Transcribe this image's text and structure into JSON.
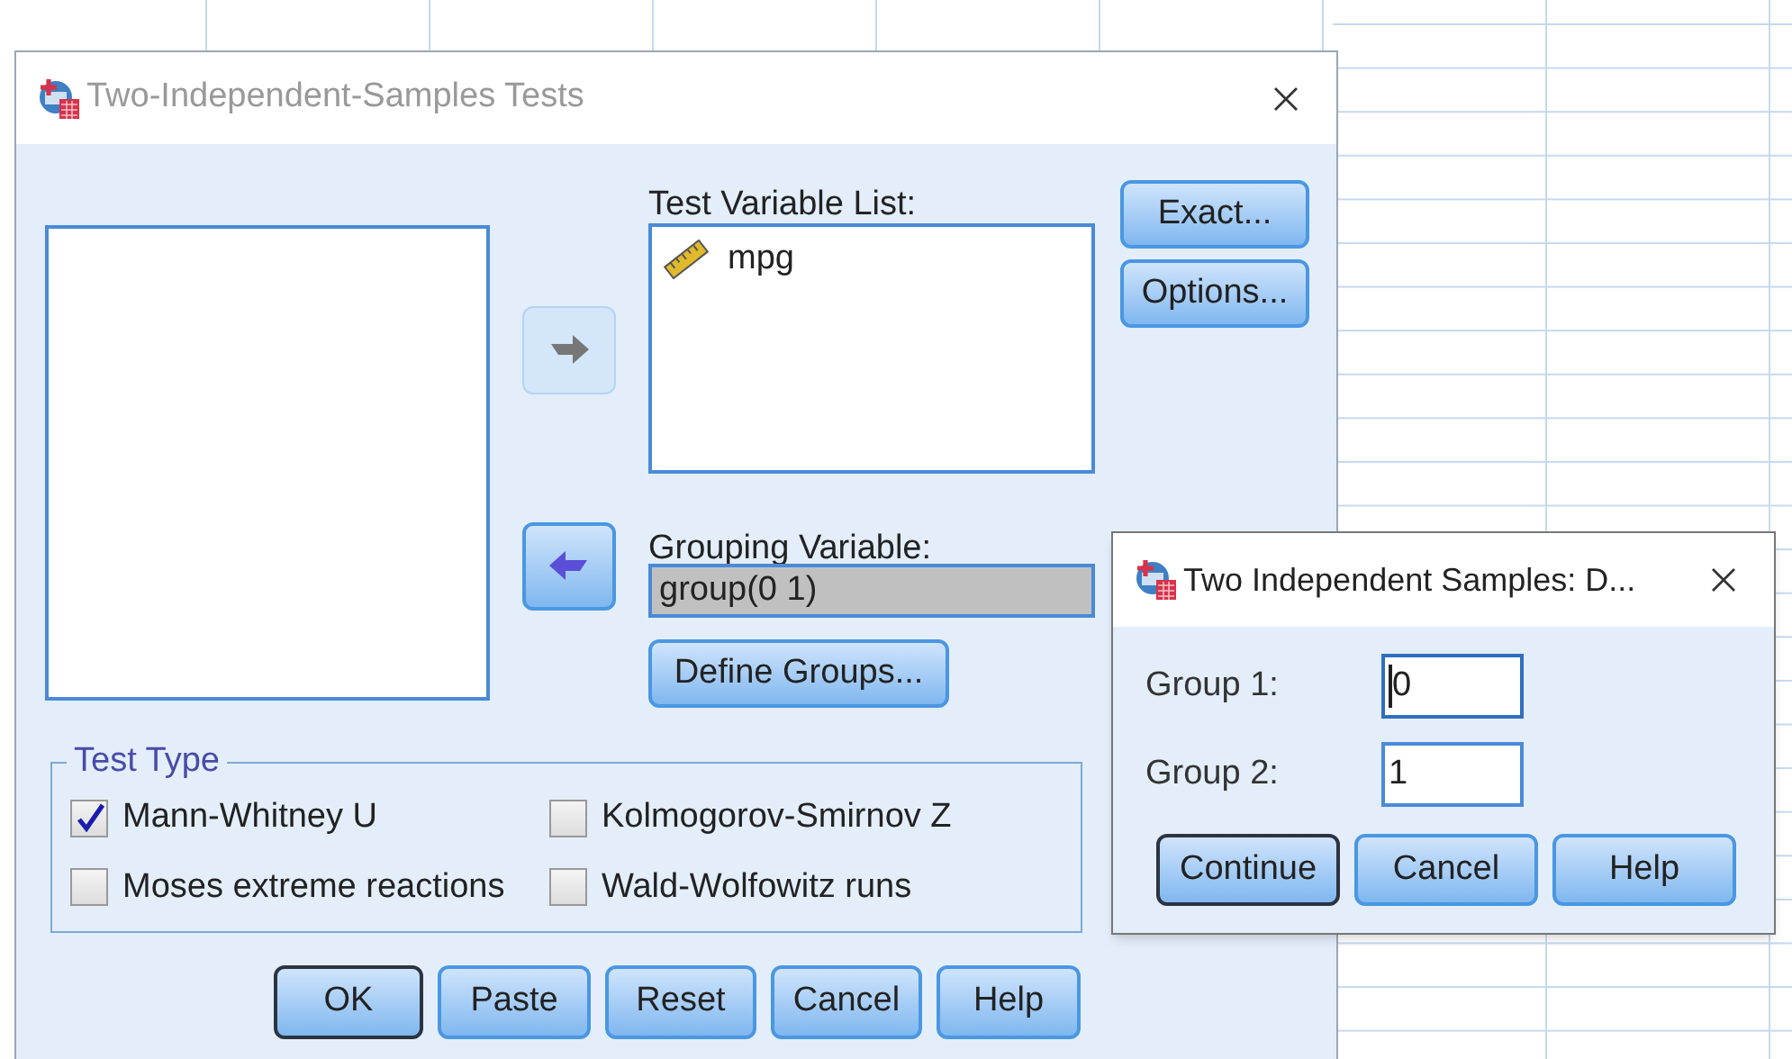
{
  "main_dialog": {
    "title": "Two-Independent-Samples Tests",
    "move_buttons": [
      {
        "disabled": true
      },
      {
        "disabled": false
      }
    ],
    "test_variable_list": {
      "label": "Test Variable List:",
      "items": [
        {
          "name": "mpg"
        }
      ]
    },
    "side_buttons": [
      "Exact...",
      "Options..."
    ],
    "grouping_variable": {
      "label": "Grouping Variable:",
      "value": "group(0 1)"
    },
    "define_groups_button": "Define Groups...",
    "test_type": {
      "title": "Test Type",
      "options": [
        {
          "label": "Mann-Whitney U",
          "checked": true
        },
        {
          "label": "Kolmogorov-Smirnov Z",
          "checked": false
        },
        {
          "label": "Moses extreme reactions",
          "checked": false
        },
        {
          "label": "Wald-Wolfowitz runs",
          "checked": false
        }
      ]
    },
    "buttons": [
      {
        "label": "OK",
        "default": true
      },
      {
        "label": "Paste",
        "default": false
      },
      {
        "label": "Reset",
        "default": false
      },
      {
        "label": "Cancel",
        "default": false
      },
      {
        "label": "Help",
        "default": false
      }
    ]
  },
  "define_groups_dialog": {
    "title": "Two Independent Samples: D...",
    "fields": [
      {
        "label": "Group 1:",
        "value": "0",
        "focused": true
      },
      {
        "label": "Group 2:",
        "value": "1",
        "focused": false
      }
    ],
    "buttons": [
      {
        "label": "Continue",
        "default": true
      },
      {
        "label": "Cancel",
        "default": false
      },
      {
        "label": "Help",
        "default": false
      }
    ]
  }
}
